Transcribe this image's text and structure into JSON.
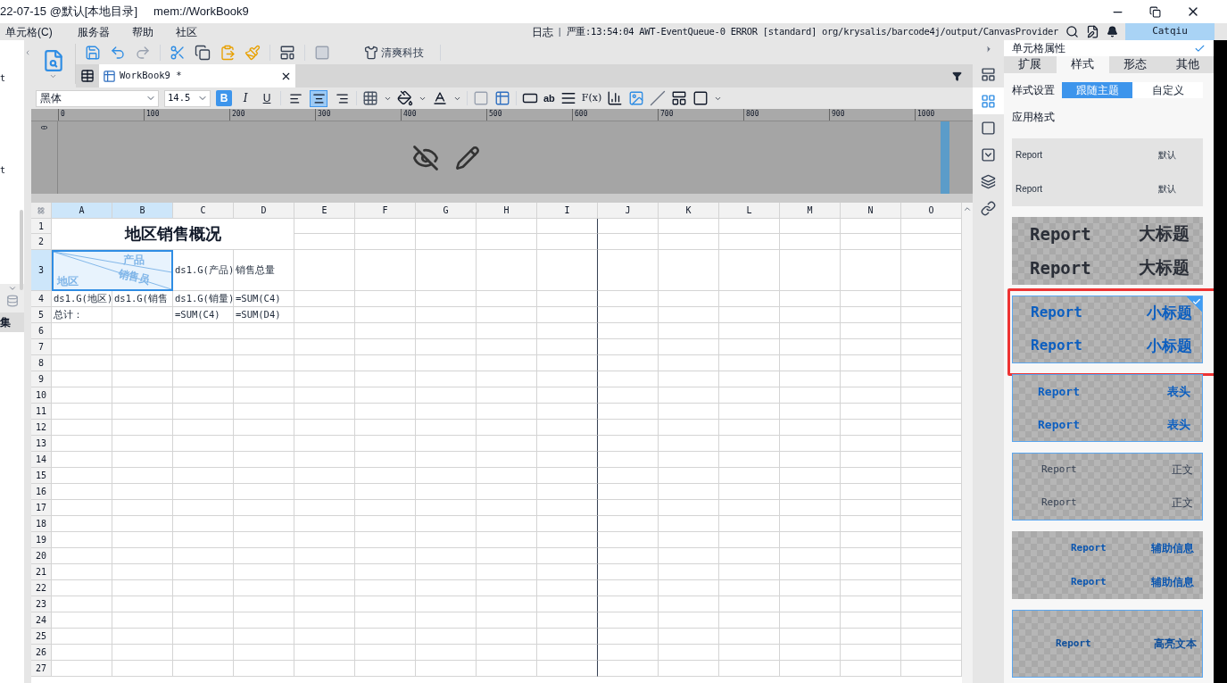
{
  "window": {
    "workspace": "22-07-15 @默认[本地目录]",
    "path": "mem://WorkBook9"
  },
  "menu": [
    "单元格(C)",
    "服务器",
    "帮助",
    "社区"
  ],
  "log": {
    "label": "日志",
    "separator": "|",
    "message": "严重:13:54:04 AWT-EventQueue-0 ERROR [standard] org/krysalis/barcode4j/output/CanvasProvider"
  },
  "user": "Catqiu",
  "left_panel": {
    "texts": [
      "t",
      "t"
    ],
    "tab": "集"
  },
  "toolbar": {
    "theme_button": "清爽科技"
  },
  "document_tab": {
    "title": "WorkBook9 *"
  },
  "format": {
    "font": "黑体",
    "size": "14.5",
    "styles": [
      {
        "kind": "bold",
        "label": "B",
        "selected": true
      },
      {
        "kind": "italic",
        "label": "I",
        "selected": false
      },
      {
        "kind": "underline",
        "label": "U",
        "selected": false
      }
    ],
    "aligns": [
      {
        "kind": "left",
        "selected": false
      },
      {
        "kind": "center",
        "selected": true
      },
      {
        "kind": "right",
        "selected": false
      }
    ],
    "tools": [
      "ab",
      "F(x)"
    ]
  },
  "ruler": {
    "ticks": [
      "0",
      "100",
      "200",
      "300",
      "400",
      "500",
      "600",
      "700",
      "800",
      "900",
      "1000"
    ],
    "vertical": "0"
  },
  "sheet": {
    "columns": [
      {
        "label": "A",
        "selected": true
      },
      {
        "label": "B",
        "selected": true
      },
      {
        "label": "C",
        "selected": false
      },
      {
        "label": "D",
        "selected": false
      },
      {
        "label": "E",
        "selected": false
      },
      {
        "label": "F",
        "selected": false
      },
      {
        "label": "G",
        "selected": false
      },
      {
        "label": "H",
        "selected": false
      },
      {
        "label": "I",
        "selected": false
      },
      {
        "label": "J",
        "selected": false
      },
      {
        "label": "K",
        "selected": false
      },
      {
        "label": "L",
        "selected": false
      },
      {
        "label": "M",
        "selected": false
      },
      {
        "label": "N",
        "selected": false
      },
      {
        "label": "O",
        "selected": false
      }
    ],
    "rows": [
      {
        "label": "1",
        "selected": false
      },
      {
        "label": "2",
        "selected": false
      },
      {
        "label": "3",
        "selected": true
      },
      {
        "label": "4",
        "selected": false
      },
      {
        "label": "5",
        "selected": false
      },
      {
        "label": "6",
        "selected": false
      },
      {
        "label": "7",
        "selected": false
      },
      {
        "label": "8",
        "selected": false
      },
      {
        "label": "9",
        "selected": false
      },
      {
        "label": "10",
        "selected": false
      },
      {
        "label": "11",
        "selected": false
      },
      {
        "label": "12",
        "selected": false
      },
      {
        "label": "13",
        "selected": false
      },
      {
        "label": "14",
        "selected": false
      },
      {
        "label": "15",
        "selected": false
      },
      {
        "label": "16",
        "selected": false
      },
      {
        "label": "17",
        "selected": false
      },
      {
        "label": "18",
        "selected": false
      },
      {
        "label": "19",
        "selected": false
      },
      {
        "label": "20",
        "selected": false
      },
      {
        "label": "21",
        "selected": false
      },
      {
        "label": "22",
        "selected": false
      },
      {
        "label": "23",
        "selected": false
      },
      {
        "label": "24",
        "selected": false
      },
      {
        "label": "25",
        "selected": false
      },
      {
        "label": "26",
        "selected": false
      },
      {
        "label": "27",
        "selected": false
      }
    ],
    "title": "地区销售概况",
    "diagonal": {
      "top": "产品",
      "middle": "销售员",
      "bottom": "地区",
      "selected": true
    },
    "row3": [
      "ds1.G(产品)",
      "销售总量"
    ],
    "row4": [
      "ds1.G(地区)",
      "ds1.G(销售",
      "ds1.G(销量)",
      "=SUM(C4)"
    ],
    "row5": [
      "总计：",
      "=SUM(C4)",
      "=SUM(D4)"
    ]
  },
  "side_tools": [
    {
      "kind": "layout",
      "selected": false
    },
    {
      "kind": "cell",
      "selected": true
    },
    {
      "kind": "frame",
      "selected": false
    },
    {
      "kind": "dropdown",
      "selected": false
    },
    {
      "kind": "stack",
      "selected": false
    },
    {
      "kind": "link",
      "selected": false
    }
  ],
  "panel": {
    "title": "单元格属性",
    "tabs": [
      {
        "label": "扩展",
        "selected": false
      },
      {
        "label": "样式",
        "selected": true
      },
      {
        "label": "形态",
        "selected": false
      },
      {
        "label": "其他",
        "selected": false
      }
    ],
    "style_setting": {
      "label": "样式设置",
      "options": [
        {
          "label": "跟随主题",
          "selected": true
        },
        {
          "label": "自定义",
          "selected": false
        }
      ]
    },
    "apply_label": "应用格式",
    "presets": [
      {
        "kind": "default",
        "selected": false,
        "annotated": false,
        "lines": [
          {
            "sample": "Report",
            "name": "默认"
          },
          {
            "sample": "Report",
            "name": "默认"
          }
        ]
      },
      {
        "kind": "big-title",
        "selected": false,
        "annotated": false,
        "lines": [
          {
            "sample": "Report",
            "name": "大标题"
          },
          {
            "sample": "Report",
            "name": "大标题"
          }
        ]
      },
      {
        "kind": "subtitle",
        "selected": true,
        "annotated": true,
        "lines": [
          {
            "sample": "Report",
            "name": "小标题"
          },
          {
            "sample": "Report",
            "name": "小标题"
          }
        ]
      },
      {
        "kind": "header",
        "selected": false,
        "annotated": false,
        "lines": [
          {
            "sample": "Report",
            "name": "表头"
          },
          {
            "sample": "Report",
            "name": "表头"
          }
        ]
      },
      {
        "kind": "body",
        "selected": false,
        "annotated": false,
        "lines": [
          {
            "sample": "Report",
            "name": "正文"
          },
          {
            "sample": "Report",
            "name": "正文"
          }
        ]
      },
      {
        "kind": "aux",
        "selected": false,
        "annotated": false,
        "lines": [
          {
            "sample": "Report",
            "name": "辅助信息"
          },
          {
            "sample": "Report",
            "name": "辅助信息"
          }
        ]
      },
      {
        "kind": "highlight",
        "selected": false,
        "annotated": false,
        "lines": [
          {
            "sample": "Report",
            "name": "高亮文本"
          }
        ]
      }
    ]
  }
}
